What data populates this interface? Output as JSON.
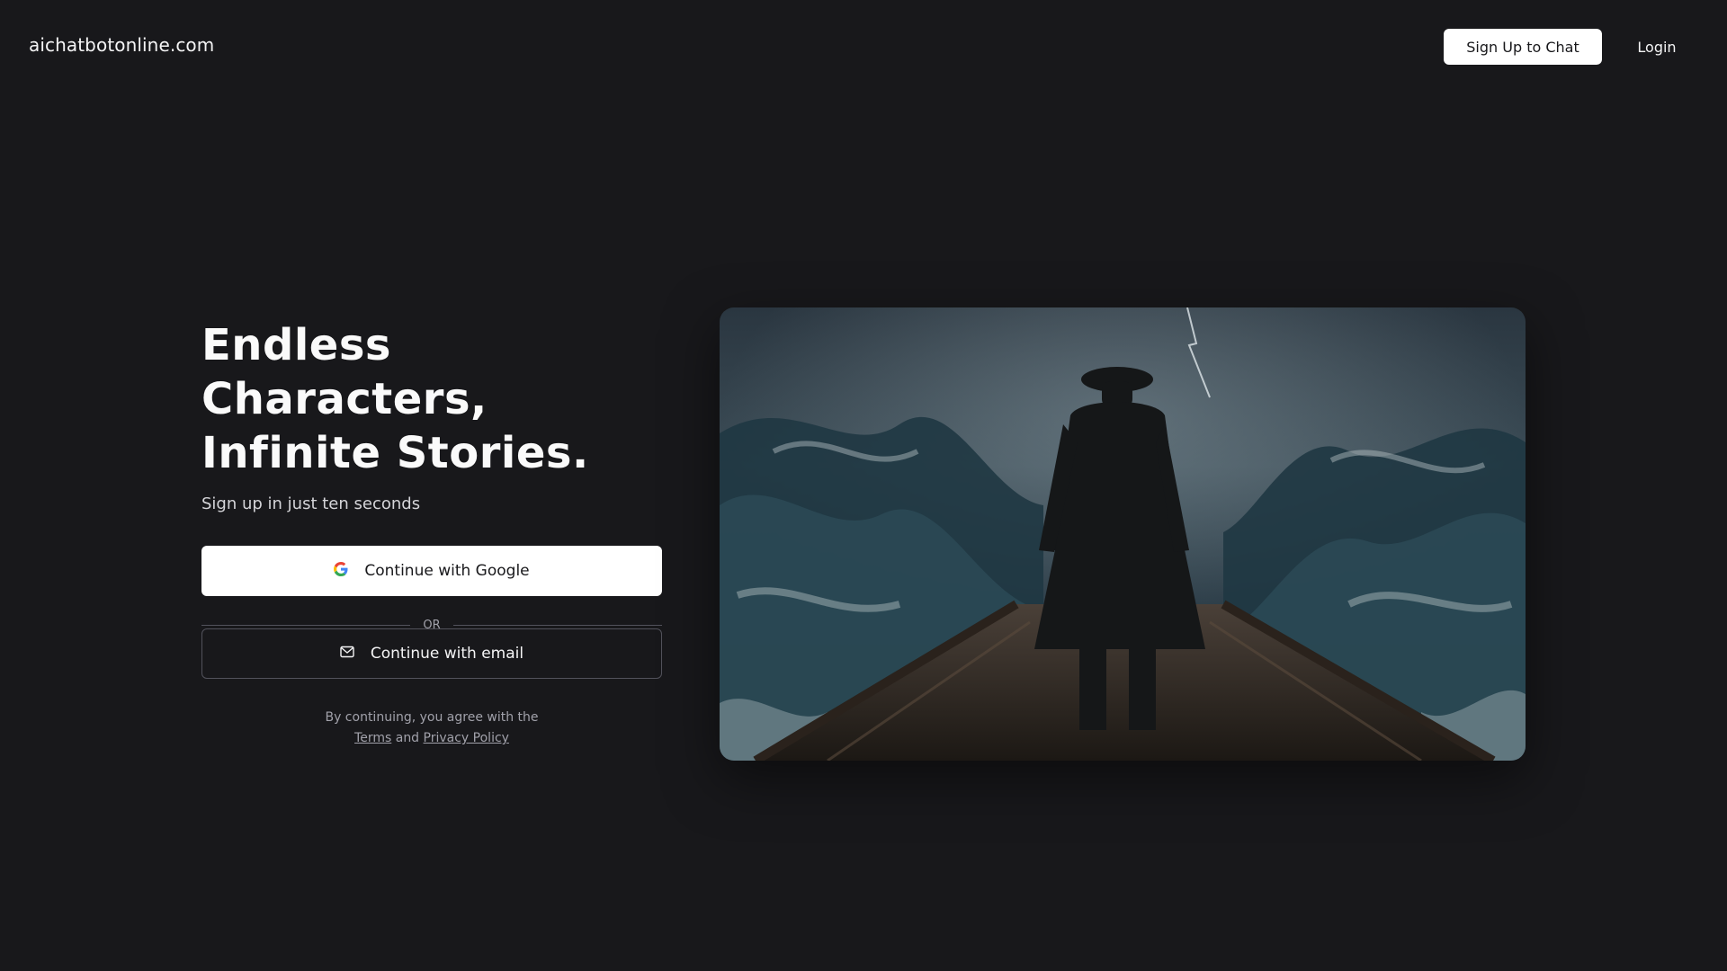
{
  "header": {
    "brand": "aichatbotonline.com",
    "signup_label": "Sign Up to Chat",
    "login_label": "Login"
  },
  "hero": {
    "title_lines": [
      "Endless",
      "Characters,",
      "Infinite Stories."
    ],
    "subtitle": "Sign up in just ten seconds",
    "google_label": "Continue with Google",
    "or_label": "OR",
    "email_label": "Continue with email",
    "legal_prefix": "By continuing, you agree with the",
    "terms_label": "Terms",
    "and_label": "and",
    "privacy_label": "Privacy Policy"
  },
  "image": {
    "description_icon": "pirate-on-ship-storm-illustration"
  },
  "colors": {
    "background": "#18181b",
    "button_light": "#ffffff",
    "border": "#52525b",
    "muted_text": "#a1a1aa"
  }
}
